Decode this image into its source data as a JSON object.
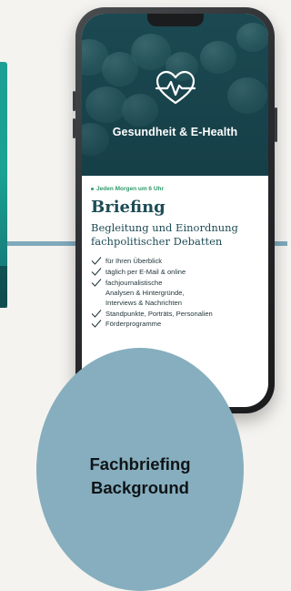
{
  "phone": {
    "hero_title": "Gesundheit & E-Health",
    "hero_icon": "heart-pulse-icon",
    "eyebrow": "Jeden Morgen um 6 Uhr",
    "headline": "Briefing",
    "subhead": "Begleitung und Einordnung\nfachpolitischer Debatten",
    "features": [
      {
        "text": "für Ihren Überblick"
      },
      {
        "text": "täglich per E-Mail & online"
      },
      {
        "text": "fachjournalistische\nAnalysen & Hintergründe,\nInterviews & Nachrichten"
      },
      {
        "text": "Standpunkte, Porträts, Personalien"
      },
      {
        "text": "Förderprogramme"
      }
    ]
  },
  "circle": {
    "line1": "Fachbriefing",
    "line2": "Background"
  },
  "colors": {
    "background": "#f5f3ef",
    "accent_blue": "#86aebe",
    "hero_teal": "#1f4f58",
    "headline": "#1e4c56",
    "eyebrow_green": "#2f9a6a"
  }
}
